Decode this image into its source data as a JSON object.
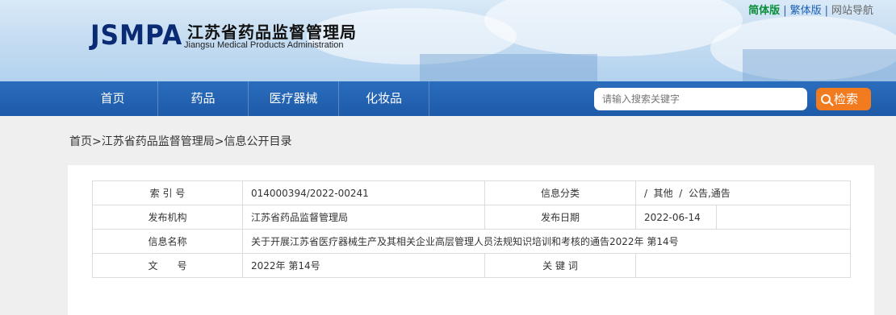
{
  "header": {
    "logo_mark": "JSMPA",
    "org_name_cn": "江苏省药品监督管理局",
    "org_name_en": "Jiangsu Medical Products Administration",
    "top_links": {
      "simplified": "简体版",
      "traditional": "繁体版",
      "sitemap": "网站导航",
      "separator": "|"
    }
  },
  "nav": {
    "items": [
      "首页",
      "药品",
      "医疗器械",
      "化妆品"
    ],
    "search_placeholder": "请输入搜索关键字",
    "search_button": "检索"
  },
  "breadcrumb": "首页>江苏省药品监督管理局>信息公开目录",
  "info_table": {
    "index_label": "索 引 号",
    "index_value": "014000394/2022-00241",
    "category_label": "信息分类",
    "category_value": "/  其他  /  公告,通告",
    "publisher_label": "发布机构",
    "publisher_value": "江苏省药品监督管理局",
    "date_label": "发布日期",
    "date_value": "2022-06-14",
    "name_label": "信息名称",
    "name_value": "关于开展江苏省医疗器械生产及其相关企业高层管理人员法规知识培训和考核的通告2022年 第14号",
    "docno_label": "文　　号",
    "docno_value": "2022年 第14号",
    "keywords_label": "关 键 词",
    "keywords_value": ""
  },
  "colors": {
    "nav_blue": "#1d5aa8",
    "search_orange": "#f37b1f",
    "simplified_green": "#0b8f3a",
    "logo_navy": "#0a2a73"
  }
}
